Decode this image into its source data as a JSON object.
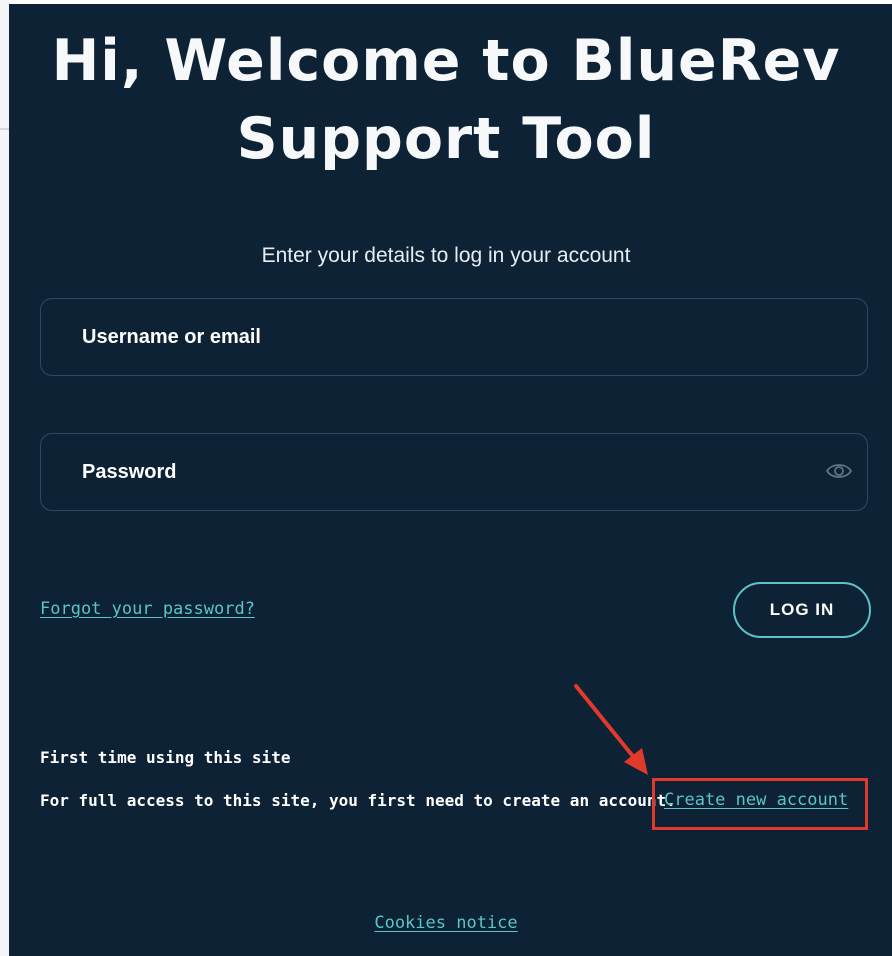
{
  "login": {
    "heading": "Hi, Welcome to BlueRev Support Tool",
    "subtitle": "Enter your details to log in your account",
    "username_placeholder": "Username or email",
    "password_placeholder": "Password",
    "forgot_password_link": "Forgot your password?",
    "login_button": "LOG IN"
  },
  "signup": {
    "heading": "First time using this site",
    "text": "For full access to this site, you first need to create an account.",
    "create_account_link": "Create new account"
  },
  "footer": {
    "cookies_link": "Cookies notice"
  },
  "icons": {
    "show_password": "eye-icon",
    "annotation": "red-arrow"
  },
  "colors": {
    "background": "#0d2235",
    "accent": "#5cc4c7",
    "annotation": "#e2392d",
    "field_border": "#2e4a63"
  }
}
